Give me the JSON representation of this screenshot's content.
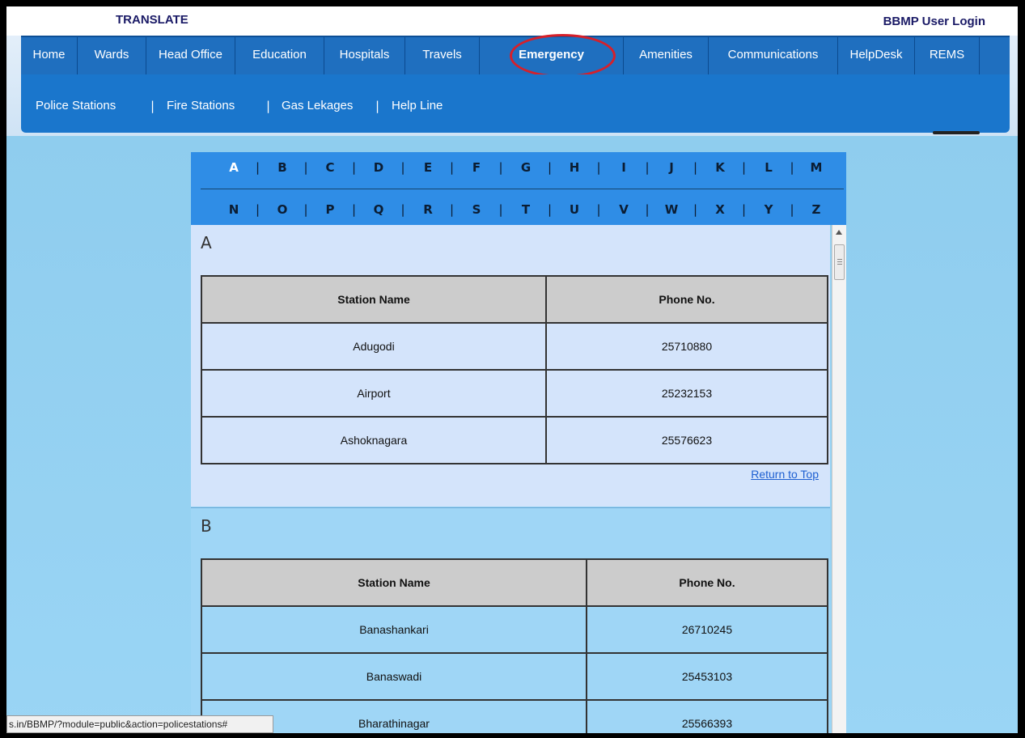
{
  "top": {
    "translate": "TRANSLATE",
    "login": "BBMP User Login"
  },
  "nav": [
    "Home",
    "Wards",
    "Head Office",
    "Education",
    "Hospitals",
    "Travels",
    "Emergency",
    "Amenities",
    "Communications",
    "HelpDesk",
    "REMS"
  ],
  "active_nav": "Emergency",
  "subnav": [
    "Police Stations",
    "Fire Stations",
    "Gas Lekages",
    "Help Line"
  ],
  "alphabet_row1": [
    "A",
    "B",
    "C",
    "D",
    "E",
    "F",
    "G",
    "H",
    "I",
    "J",
    "K",
    "L",
    "M"
  ],
  "alphabet_row2": [
    "N",
    "O",
    "P",
    "Q",
    "R",
    "S",
    "T",
    "U",
    "V",
    "W",
    "X",
    "Y",
    "Z"
  ],
  "sections": [
    {
      "letter": "A",
      "headers": [
        "Station Name",
        "Phone No."
      ],
      "rows": [
        [
          "Adugodi",
          "25710880"
        ],
        [
          "Airport",
          "25232153"
        ],
        [
          "Ashoknagara",
          "25576623"
        ]
      ],
      "return_label": "Return to Top"
    },
    {
      "letter": "B",
      "headers": [
        "Station Name",
        "Phone No."
      ],
      "rows": [
        [
          "Banashankari",
          "26710245"
        ],
        [
          "Banaswadi",
          "25453103"
        ],
        [
          "Bharathinagar",
          "25566393"
        ]
      ]
    }
  ],
  "status_url": "s.in/BBMP/?module=public&action=policestations#",
  "colors": {
    "nav_bg": "#1f6fbf",
    "highlight_ring": "#d6202a",
    "alpha_bg": "#2f8de6"
  }
}
